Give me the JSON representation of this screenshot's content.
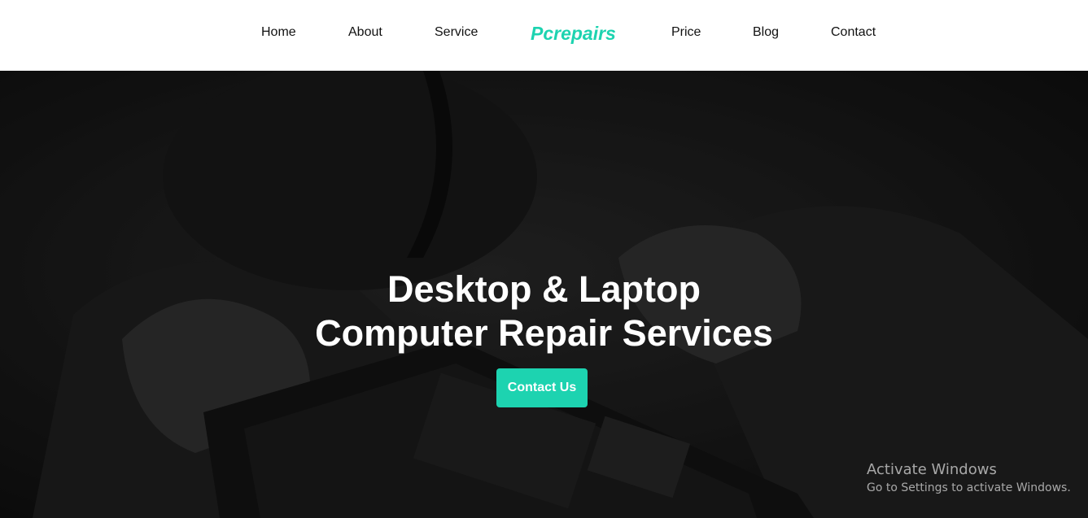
{
  "nav": {
    "home": "Home",
    "about": "About",
    "service": "Service",
    "brand": "Pcrepairs",
    "price": "Price",
    "blog": "Blog",
    "contact": "Contact"
  },
  "hero": {
    "title_line1": "Desktop & Laptop",
    "title_line2": "Computer Repair Services",
    "cta_label": "Contact Us",
    "background_image": "technician-repairing-laptop-photo"
  },
  "watermark": {
    "title": "Activate Windows",
    "subtitle": "Go to Settings to activate Windows."
  },
  "colors": {
    "accent": "#1dd3b0",
    "hero_dark": "#1a1a1a",
    "nav_bg": "#ffffff",
    "text": "#111111"
  }
}
